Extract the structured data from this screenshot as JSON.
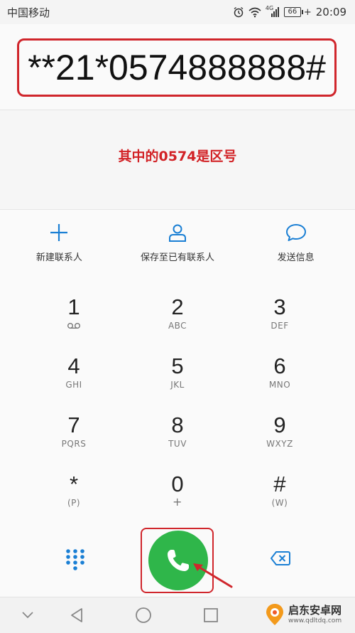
{
  "status_bar": {
    "carrier": "中国移动",
    "network": "4G",
    "battery": "66",
    "time": "20:09"
  },
  "dialer": {
    "number": "**21*0574888888#",
    "annotation": "其中的0574是区号"
  },
  "actions": [
    {
      "label": "新建联系人",
      "icon": "plus-icon"
    },
    {
      "label": "保存至已有联系人",
      "icon": "person-icon"
    },
    {
      "label": "发送信息",
      "icon": "message-icon"
    }
  ],
  "keys": [
    {
      "digit": "1",
      "sub": "voicemail-icon"
    },
    {
      "digit": "2",
      "sub": "ABC"
    },
    {
      "digit": "3",
      "sub": "DEF"
    },
    {
      "digit": "4",
      "sub": "GHI"
    },
    {
      "digit": "5",
      "sub": "JKL"
    },
    {
      "digit": "6",
      "sub": "MNO"
    },
    {
      "digit": "7",
      "sub": "PQRS"
    },
    {
      "digit": "8",
      "sub": "TUV"
    },
    {
      "digit": "9",
      "sub": "WXYZ"
    },
    {
      "digit": "*",
      "sub": "(P)"
    },
    {
      "digit": "0",
      "sub": "+"
    },
    {
      "digit": "#",
      "sub": "(W)"
    }
  ],
  "watermark": {
    "title": "启东安卓网",
    "url": "www.qdltdq.com"
  },
  "colors": {
    "accent_blue": "#1a7fd4",
    "call_green": "#2fb64a",
    "highlight_red": "#d0262c"
  }
}
